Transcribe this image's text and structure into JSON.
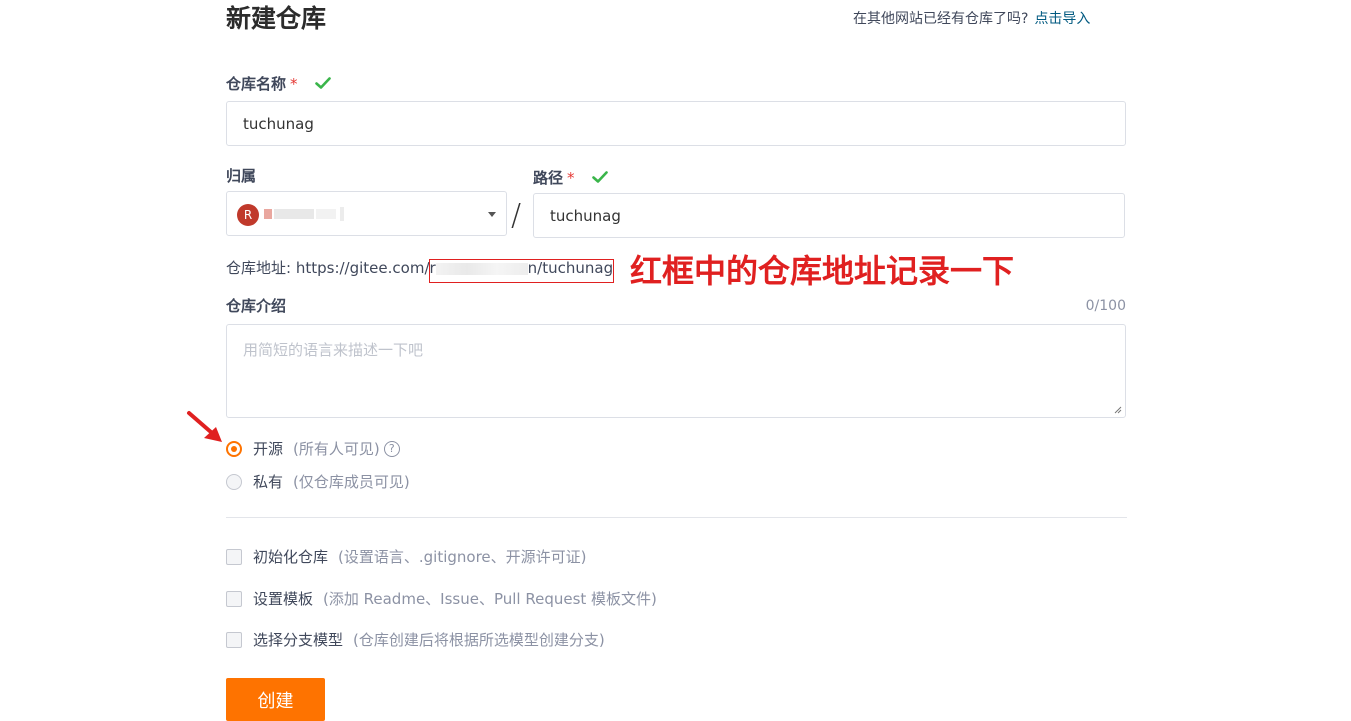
{
  "header": {
    "title": "新建仓库",
    "import_prompt": "在其他网站已经有仓库了吗?",
    "import_link": "点击导入"
  },
  "repo_name": {
    "label": "仓库名称",
    "required_mark": "*",
    "value": "tuchunag"
  },
  "owner": {
    "label": "归属",
    "avatar_letter": "R"
  },
  "separator": "/",
  "path": {
    "label": "路径",
    "required_mark": "*",
    "value": "tuchunag"
  },
  "address": {
    "label": "仓库地址:",
    "url_prefix": "https://gitee.com/r",
    "url_suffix": "n/tuchunag"
  },
  "annotation": "红框中的仓库地址记录一下",
  "description": {
    "label": "仓库介绍",
    "counter": "0/100",
    "placeholder": "用简短的语言来描述一下吧"
  },
  "visibility": {
    "options": [
      {
        "label": "开源",
        "hint": "(所有人可见)",
        "selected": true
      },
      {
        "label": "私有",
        "hint": "(仅仓库成员可见)",
        "selected": false
      }
    ],
    "help_glyph": "?"
  },
  "options": [
    {
      "label": "初始化仓库",
      "hint": "(设置语言、.gitignore、开源许可证)",
      "checked": false
    },
    {
      "label": "设置模板",
      "hint": "(添加 Readme、Issue、Pull Request 模板文件)",
      "checked": false
    },
    {
      "label": "选择分支模型",
      "hint": "(仓库创建后将根据所选模型创建分支)",
      "checked": false
    }
  ],
  "submit": {
    "label": "创建"
  },
  "colors": {
    "accent": "#fe7300",
    "annotation_red": "#e02020",
    "success_green": "#3ab54a",
    "link": "#005980"
  }
}
